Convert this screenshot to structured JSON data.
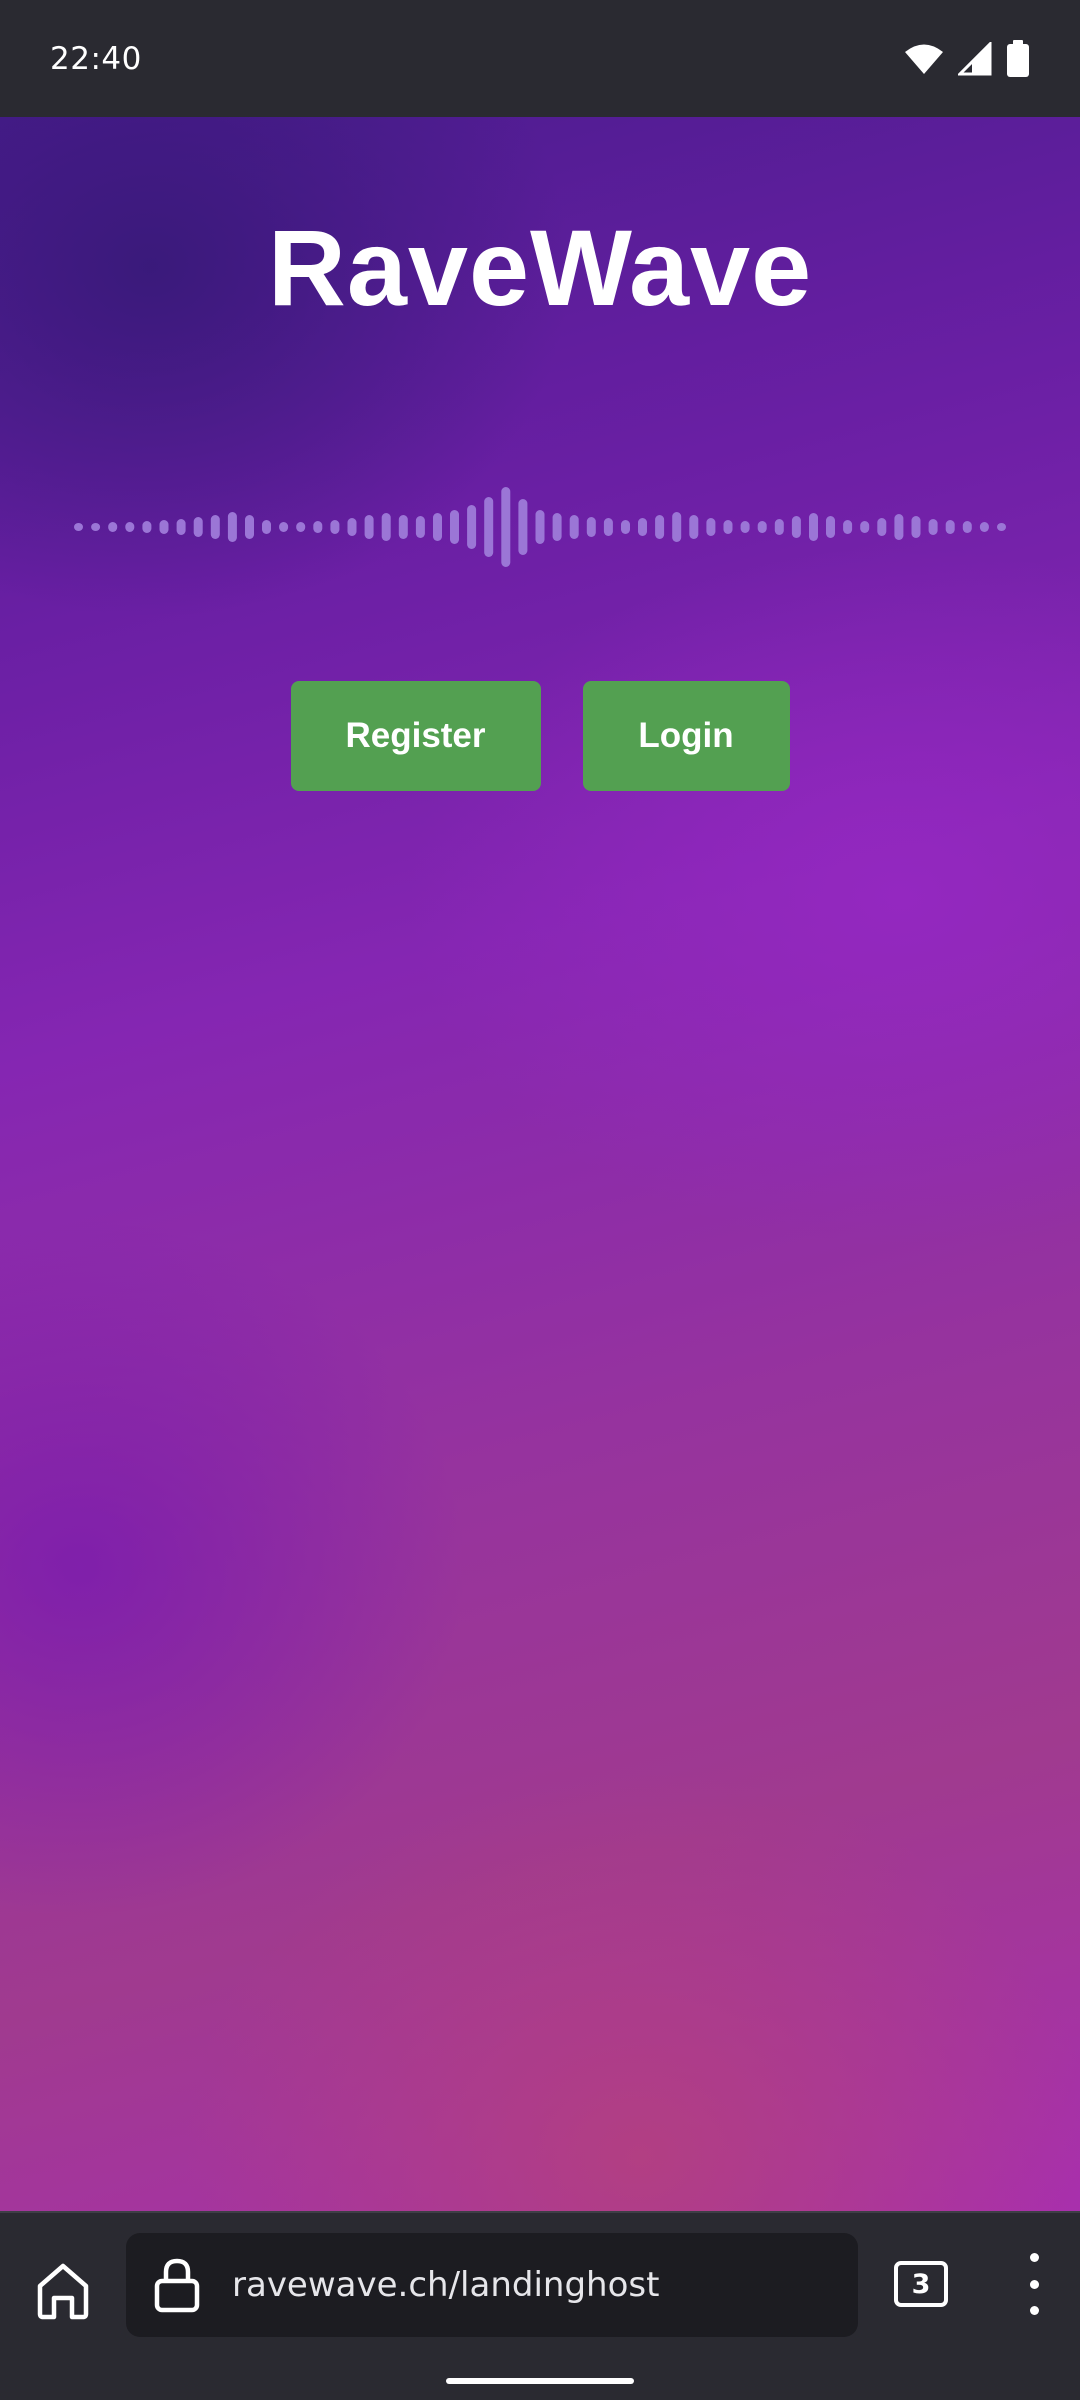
{
  "status_bar": {
    "time": "22:40",
    "icons": [
      "wifi-icon",
      "cell-signal-icon",
      "battery-icon"
    ]
  },
  "page": {
    "title": "RaveWave",
    "waveform_icon": "audio-waveform-icon",
    "register_label": "Register",
    "login_label": "Login",
    "colors": {
      "button": "#53a051",
      "gradient_top": "#4a1c8e",
      "gradient_mid": "#8526b2",
      "gradient_bottom": "#a82fae",
      "waveform": "#9b76d6"
    }
  },
  "browser": {
    "url": "ravewave.ch/landinghost",
    "tab_count": "3",
    "icons": [
      "home-icon",
      "lock-icon",
      "tabs-icon",
      "more-menu-icon"
    ]
  }
}
